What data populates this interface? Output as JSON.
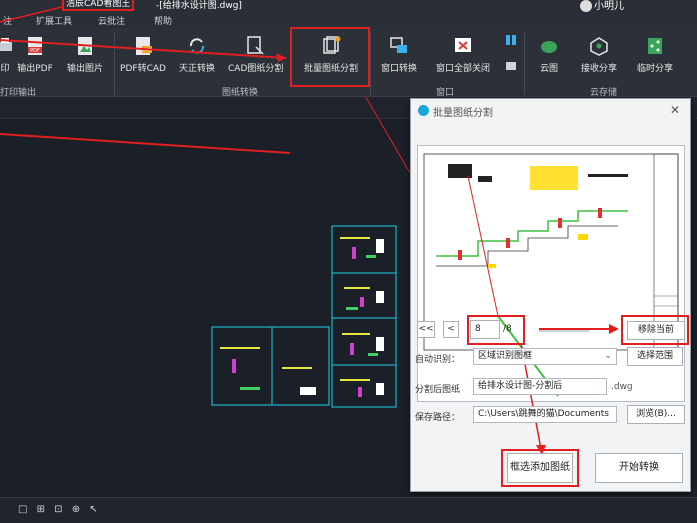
{
  "titlebar": {
    "app_title": "浩辰CAD看图王",
    "file_title": "-[给排水设计图.dwg]",
    "user_name": "小明儿"
  },
  "menu": [
    "注",
    "扩展工具",
    "云批注",
    "帮助"
  ],
  "ribbon": {
    "groups": {
      "print_output": "打印输出",
      "drawing_convert": "图纸转换",
      "window": "窗口",
      "cloud_storage": "云存储"
    },
    "buttons": {
      "print": "印",
      "export_pdf": "输出PDF",
      "export_image": "输出图片",
      "pdf_to_cad": "PDF转CAD",
      "tianzheng_convert": "天正转换",
      "cad_split": "CAD图纸分割",
      "batch_split": "批量图纸分割",
      "window_convert": "窗口转换",
      "close_all_windows": "窗口全部关闭",
      "cloud_drawing": "云图",
      "receive_share": "接收分享",
      "temp_share": "临时分享"
    },
    "icon_text": {
      "pdf": "PDF",
      "cad": "CAD"
    }
  },
  "dialog": {
    "title": "批量图纸分割",
    "close_glyph": "✕",
    "nav": {
      "first": "<<",
      "prev": "<",
      "current_page": "8",
      "total_pages": "/8",
      "remove_current": "移除当前"
    },
    "auto_recognize_label": "自动识别：",
    "auto_recognize_value": "区域识别图框",
    "select_range": "选择范围",
    "split_drawing_label": "分割后图纸",
    "split_drawing_value": "给排水设计图-分割后",
    "dwg_suffix": ".dwg",
    "save_path_label": "保存路径：",
    "save_path_value": "C:\\Users\\跳舞的猫\\Documents",
    "browse": "浏览(B)...",
    "add_by_frame": "框选添加图纸",
    "start_convert": "开始转换"
  },
  "status": {
    "icons": "□ ⊞ ⊡ ⊕ ↖"
  },
  "colors": {
    "highlight": "#e02020",
    "ribbon_bg": "#2c3038",
    "canvas_bg": "#1b1f27",
    "cad_cyan": "#19d3e6"
  }
}
